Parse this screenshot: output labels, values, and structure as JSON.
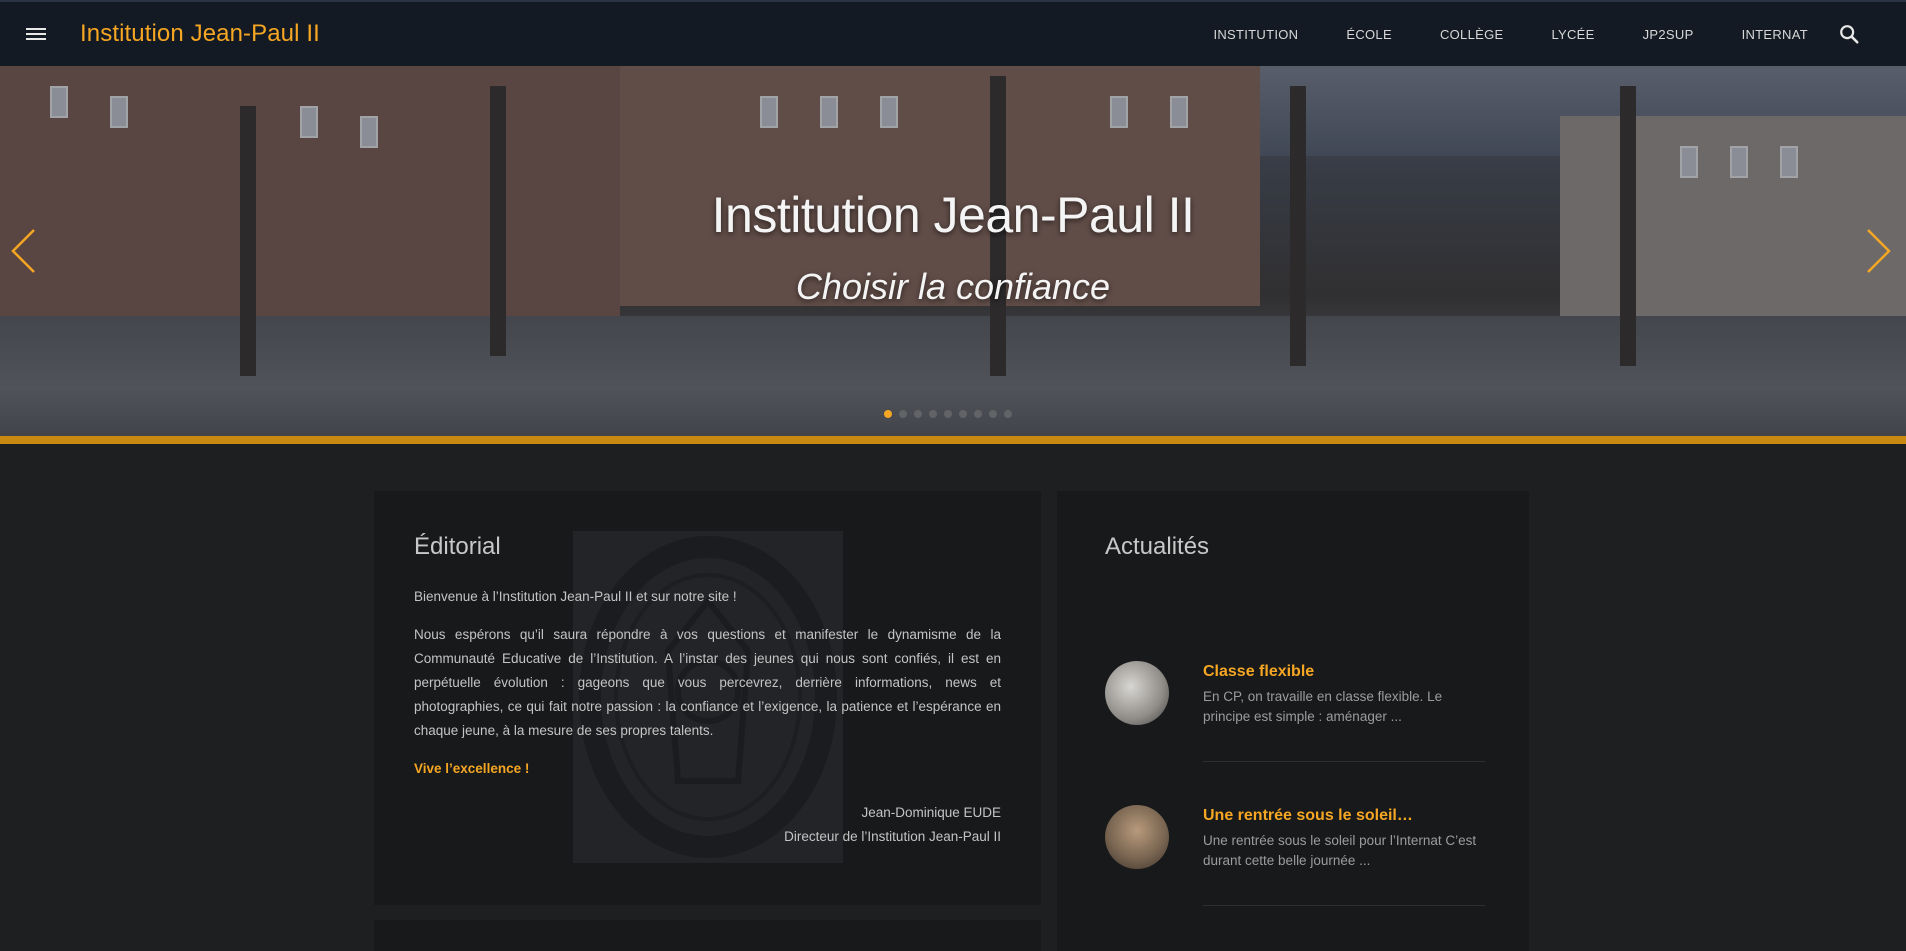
{
  "header": {
    "brand": "Institution Jean-Paul II",
    "nav": [
      "INSTITUTION",
      "ÉCOLE",
      "COLLÈGE",
      "LYCÉE",
      "JP2SUP",
      "INTERNAT"
    ]
  },
  "hero": {
    "title": "Institution Jean-Paul II",
    "subtitle": "Choisir la confiance",
    "slides_count": 9,
    "active_slide": 1
  },
  "editorial": {
    "title": "Éditorial",
    "intro": "Bienvenue à l’Institution Jean-Paul II et sur notre site !",
    "body": "Nous espérons qu’il saura répondre à vos questions et manifester le dynamisme de la Communauté Educative de l’Institution. A l’instar des jeunes qui nous sont confiés, il est en perpétuelle évolution : gageons que vous percevrez, derrière informations, news et photographies, ce qui fait notre passion : la confiance et l’exigence, la patience et l’espérance en chaque jeune, à la mesure de ses propres talents.",
    "slogan": "Vive l’excellence !",
    "signature_name": "Jean-Dominique EUDE",
    "signature_role": "Directeur de l’Institution Jean-Paul II"
  },
  "news": {
    "title": "Actualités",
    "items": [
      {
        "title": "Classe flexible",
        "excerpt": "En CP, on travaille en classe flexible. Le principe est simple : aménager ..."
      },
      {
        "title": "Une rentrée sous le soleil…",
        "excerpt": "Une rentrée sous le soleil pour l’Internat C’est durant cette belle journée ..."
      }
    ]
  },
  "colors": {
    "accent": "#f5a623",
    "topbar": "#131a23",
    "background": "#1e1f21",
    "card": "#18191b",
    "hero_bar": "#c98a12"
  },
  "icons": {
    "menu": "menu-icon",
    "search": "search-icon",
    "prev": "chevron-left-icon",
    "next": "chevron-right-icon"
  }
}
